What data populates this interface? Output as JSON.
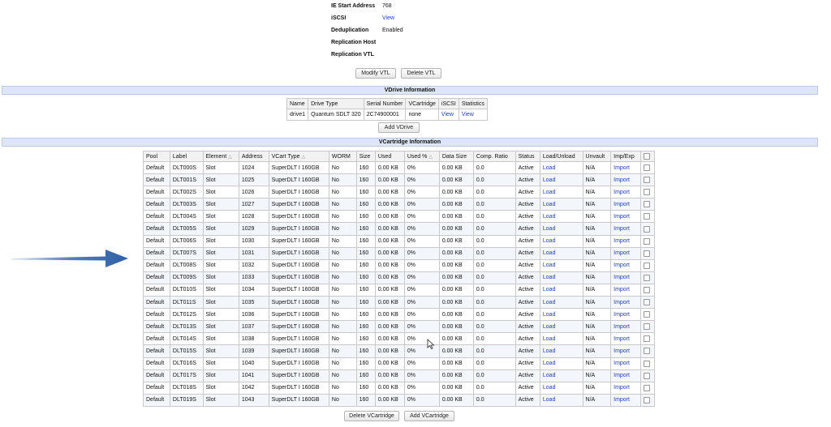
{
  "vtl_properties": [
    {
      "label": "IE Start Address",
      "value": "768",
      "is_link": false
    },
    {
      "label": "iSCSI",
      "value": "View",
      "is_link": true
    },
    {
      "label": "Deduplication",
      "value": "Enabled",
      "is_link": false
    },
    {
      "label": "Replication Host",
      "value": "",
      "is_link": false
    },
    {
      "label": "Replication VTL",
      "value": "",
      "is_link": false
    }
  ],
  "vtl_buttons": {
    "modify": "Modify VTL",
    "delete": "Delete VTL"
  },
  "vdrive": {
    "title": "VDrive Information",
    "headers": [
      "Name",
      "Drive Type",
      "Serial Number",
      "VCartridge",
      "iSCSI",
      "Statistics"
    ],
    "rows": [
      [
        "drive1",
        "Quantum SDLT 320",
        "2C74900001",
        "none",
        "View",
        "View"
      ]
    ],
    "add_button": "Add VDrive"
  },
  "vcartridge": {
    "title": "VCartridge Information",
    "headers": [
      "Pool",
      "Label",
      "Element",
      "Address",
      "VCart Type",
      "WORM",
      "Size",
      "Used",
      "Used %",
      "Data Size",
      "Comp. Ratio",
      "Status",
      "Load/Unload",
      "Unvault",
      "Imp/Exp"
    ],
    "rows": [
      [
        "Default",
        "DLT000S",
        "Slot",
        "1024",
        "SuperDLT I 160GB",
        "No",
        "160",
        "0.00 KB",
        "0%",
        "0.00 KB",
        "0.0",
        "Active",
        "Load",
        "N/A",
        "Import"
      ],
      [
        "Default",
        "DLT001S",
        "Slot",
        "1025",
        "SuperDLT I 160GB",
        "No",
        "160",
        "0.00 KB",
        "0%",
        "0.00 KB",
        "0.0",
        "Active",
        "Load",
        "N/A",
        "Import"
      ],
      [
        "Default",
        "DLT002S",
        "Slot",
        "1026",
        "SuperDLT I 160GB",
        "No",
        "160",
        "0.00 KB",
        "0%",
        "0.00 KB",
        "0.0",
        "Active",
        "Load",
        "N/A",
        "Import"
      ],
      [
        "Default",
        "DLT003S",
        "Slot",
        "1027",
        "SuperDLT I 160GB",
        "No",
        "160",
        "0.00 KB",
        "0%",
        "0.00 KB",
        "0.0",
        "Active",
        "Load",
        "N/A",
        "Import"
      ],
      [
        "Default",
        "DLT004S",
        "Slot",
        "1028",
        "SuperDLT I 160GB",
        "No",
        "160",
        "0.00 KB",
        "0%",
        "0.00 KB",
        "0.0",
        "Active",
        "Load",
        "N/A",
        "Import"
      ],
      [
        "Default",
        "DLT005S",
        "Slot",
        "1029",
        "SuperDLT I 160GB",
        "No",
        "160",
        "0.00 KB",
        "0%",
        "0.00 KB",
        "0.0",
        "Active",
        "Load",
        "N/A",
        "Import"
      ],
      [
        "Default",
        "DLT006S",
        "Slot",
        "1030",
        "SuperDLT I 160GB",
        "No",
        "160",
        "0.00 KB",
        "0%",
        "0.00 KB",
        "0.0",
        "Active",
        "Load",
        "N/A",
        "Import"
      ],
      [
        "Default",
        "DLT007S",
        "Slot",
        "1031",
        "SuperDLT I 160GB",
        "No",
        "160",
        "0.00 KB",
        "0%",
        "0.00 KB",
        "0.0",
        "Active",
        "Load",
        "N/A",
        "Import"
      ],
      [
        "Default",
        "DLT008S",
        "Slot",
        "1032",
        "SuperDLT I 160GB",
        "No",
        "160",
        "0.00 KB",
        "0%",
        "0.00 KB",
        "0.0",
        "Active",
        "Load",
        "N/A",
        "Import"
      ],
      [
        "Default",
        "DLT009S",
        "Slot",
        "1033",
        "SuperDLT I 160GB",
        "No",
        "160",
        "0.00 KB",
        "0%",
        "0.00 KB",
        "0.0",
        "Active",
        "Load",
        "N/A",
        "Import"
      ],
      [
        "Default",
        "DLT010S",
        "Slot",
        "1034",
        "SuperDLT I 160GB",
        "No",
        "160",
        "0.00 KB",
        "0%",
        "0.00 KB",
        "0.0",
        "Active",
        "Load",
        "N/A",
        "Import"
      ],
      [
        "Default",
        "DLT011S",
        "Slot",
        "1035",
        "SuperDLT I 160GB",
        "No",
        "160",
        "0.00 KB",
        "0%",
        "0.00 KB",
        "0.0",
        "Active",
        "Load",
        "N/A",
        "Import"
      ],
      [
        "Default",
        "DLT012S",
        "Slot",
        "1036",
        "SuperDLT I 160GB",
        "No",
        "160",
        "0.00 KB",
        "0%",
        "0.00 KB",
        "0.0",
        "Active",
        "Load",
        "N/A",
        "Import"
      ],
      [
        "Default",
        "DLT013S",
        "Slot",
        "1037",
        "SuperDLT I 160GB",
        "No",
        "160",
        "0.00 KB",
        "0%",
        "0.00 KB",
        "0.0",
        "Active",
        "Load",
        "N/A",
        "Import"
      ],
      [
        "Default",
        "DLT014S",
        "Slot",
        "1038",
        "SuperDLT I 160GB",
        "No",
        "160",
        "0.00 KB",
        "0%",
        "0.00 KB",
        "0.0",
        "Active",
        "Load",
        "N/A",
        "Import"
      ],
      [
        "Default",
        "DLT015S",
        "Slot",
        "1039",
        "SuperDLT I 160GB",
        "No",
        "160",
        "0.00 KB",
        "0%",
        "0.00 KB",
        "0.0",
        "Active",
        "Load",
        "N/A",
        "Import"
      ],
      [
        "Default",
        "DLT016S",
        "Slot",
        "1040",
        "SuperDLT I 160GB",
        "No",
        "160",
        "0.00 KB",
        "0%",
        "0.00 KB",
        "0.0",
        "Active",
        "Load",
        "N/A",
        "Import"
      ],
      [
        "Default",
        "DLT017S",
        "Slot",
        "1041",
        "SuperDLT I 160GB",
        "No",
        "160",
        "0.00 KB",
        "0%",
        "0.00 KB",
        "0.0",
        "Active",
        "Load",
        "N/A",
        "Import"
      ],
      [
        "Default",
        "DLT018S",
        "Slot",
        "1042",
        "SuperDLT I 160GB",
        "No",
        "160",
        "0.00 KB",
        "0%",
        "0.00 KB",
        "0.0",
        "Active",
        "Load",
        "N/A",
        "Import"
      ],
      [
        "Default",
        "DLT019S",
        "Slot",
        "1043",
        "SuperDLT I 160GB",
        "No",
        "160",
        "0.00 KB",
        "0%",
        "0.00 KB",
        "0.0",
        "Active",
        "Load",
        "N/A",
        "Import"
      ]
    ],
    "delete_button": "Delete VCartridge",
    "add_button": "Add VCartridge"
  },
  "colors": {
    "link": "#1f3fbf",
    "section_bar": "#dde6f4",
    "arrow": "#2d5fa8"
  },
  "icons": [
    "sort-icon",
    "checkbox-icon",
    "arrow-annotation-icon",
    "mouse-cursor-icon"
  ]
}
